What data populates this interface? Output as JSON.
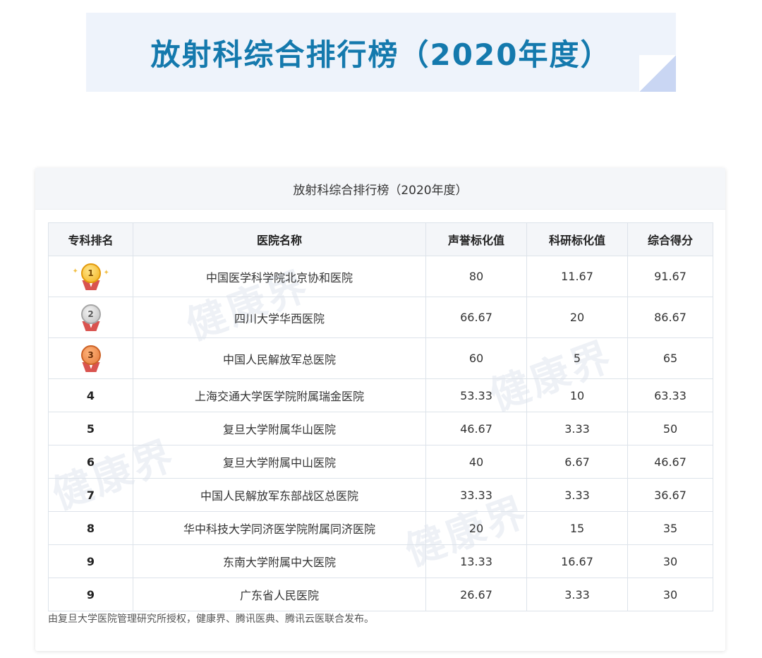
{
  "banner": {
    "title": "放射科综合排行榜（2020年度）"
  },
  "card": {
    "title": "放射科综合排行榜（2020年度）",
    "watermark": "健康界",
    "footnote": "由复旦大学医院管理研究所授权，健康界、腾讯医典、腾讯云医联合发布。"
  },
  "table": {
    "headers": [
      "专科排名",
      "医院名称",
      "声誉标化值",
      "科研标化值",
      "综合得分"
    ],
    "rows": [
      {
        "rank": "1",
        "medal": "gold-medal-icon",
        "hospital": "中国医学科学院北京协和医院",
        "reputation": "80",
        "research": "11.67",
        "score": "91.67"
      },
      {
        "rank": "2",
        "medal": "silver-medal-icon",
        "hospital": "四川大学华西医院",
        "reputation": "66.67",
        "research": "20",
        "score": "86.67"
      },
      {
        "rank": "3",
        "medal": "bronze-medal-icon",
        "hospital": "中国人民解放军总医院",
        "reputation": "60",
        "research": "5",
        "score": "65"
      },
      {
        "rank": "4",
        "hospital": "上海交通大学医学院附属瑞金医院",
        "reputation": "53.33",
        "research": "10",
        "score": "63.33"
      },
      {
        "rank": "5",
        "hospital": "复旦大学附属华山医院",
        "reputation": "46.67",
        "research": "3.33",
        "score": "50"
      },
      {
        "rank": "6",
        "hospital": "复旦大学附属中山医院",
        "reputation": "40",
        "research": "6.67",
        "score": "46.67"
      },
      {
        "rank": "7",
        "hospital": "中国人民解放军东部战区总医院",
        "reputation": "33.33",
        "research": "3.33",
        "score": "36.67"
      },
      {
        "rank": "8",
        "hospital": "华中科技大学同济医学院附属同济医院",
        "reputation": "20",
        "research": "15",
        "score": "35"
      },
      {
        "rank": "9",
        "hospital": "东南大学附属中大医院",
        "reputation": "13.33",
        "research": "16.67",
        "score": "30"
      },
      {
        "rank": "9",
        "hospital": "广东省人民医院",
        "reputation": "26.67",
        "research": "3.33",
        "score": "30"
      }
    ]
  },
  "colors": {
    "title": "#1479ad",
    "banner_bg": "#eef3fb",
    "grid": "#dde3ea"
  }
}
